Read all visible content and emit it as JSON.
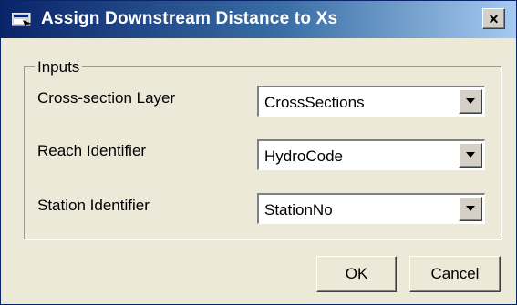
{
  "window": {
    "title": "Assign Downstream Distance to Xs",
    "close_label": "×"
  },
  "inputs": {
    "legend": "Inputs",
    "fields": [
      {
        "label": "Cross-section Layer",
        "value": "CrossSections"
      },
      {
        "label": "Reach Identifier",
        "value": "HydroCode"
      },
      {
        "label": "Station Identifier",
        "value": "StationNo"
      }
    ]
  },
  "buttons": {
    "ok": "OK",
    "cancel": "Cancel"
  },
  "icons": {
    "title": "app-window-icon",
    "dropdown": "chevron-down-icon",
    "close": "close-icon"
  },
  "colors": {
    "titlebar_start": "#0a246a",
    "titlebar_end": "#a6caf0",
    "window_bg": "#ece9d8"
  }
}
